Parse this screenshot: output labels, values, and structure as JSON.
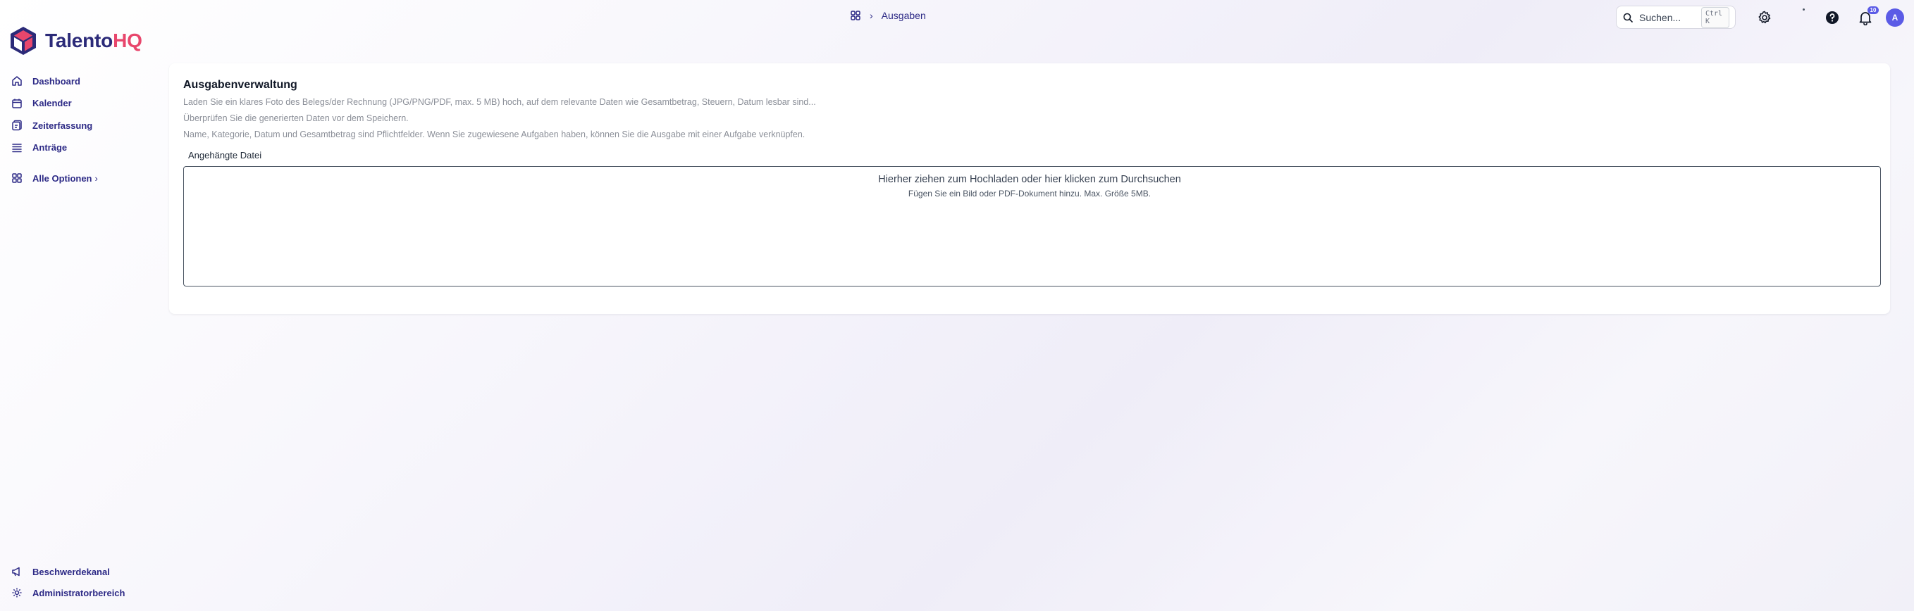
{
  "brand": {
    "name_part1": "Talento",
    "name_part2": "HQ"
  },
  "sidebar": {
    "items": [
      {
        "label": "Dashboard",
        "icon": "home-icon"
      },
      {
        "label": "Kalender",
        "icon": "calendar-icon"
      },
      {
        "label": "Zeiterfassung",
        "icon": "clipboard-clock-icon"
      },
      {
        "label": "Anträge",
        "icon": "list-icon"
      }
    ],
    "all_options": {
      "label": "Alle Optionen",
      "chevron": "›",
      "icon": "grid-icon"
    },
    "bottom": [
      {
        "label": "Beschwerdekanal",
        "icon": "megaphone-icon"
      },
      {
        "label": "Administratorbereich",
        "icon": "gear-icon"
      }
    ]
  },
  "breadcrumb": {
    "separator": "›",
    "current": "Ausgaben",
    "icon": "apps-grid-icon"
  },
  "search": {
    "placeholder": "Suchen...",
    "shortcut": "Ctrl K"
  },
  "header_icons": {
    "settings": "gear-icon",
    "help": "question-circle-icon",
    "notifications": "bell-icon",
    "notification_count": "10"
  },
  "user": {
    "avatar_initial": "A",
    "avatar_color": "#5b5be6"
  },
  "card": {
    "title": "Ausgabenverwaltung",
    "desc1": "Laden Sie ein klares Foto des Belegs/der Rechnung (JPG/PNG/PDF, max. 5 MB) hoch, auf dem relevante Daten wie Gesamtbetrag, Steuern, Datum lesbar sind...",
    "desc2": "Überprüfen Sie die generierten Daten vor dem Speichern.",
    "desc3": "Name, Kategorie, Datum und Gesamtbetrag sind Pflichtfelder. Wenn Sie zugewiesene Aufgaben haben, können Sie die Ausgabe mit einer Aufgabe verknüpfen.",
    "file_label": "Angehängte Datei",
    "dropzone_main": "Hierher ziehen zum Hochladen oder hier klicken zum Durchsuchen",
    "dropzone_sub": "Fügen Sie ein Bild oder PDF-Dokument hinzu. Max. Größe 5MB."
  },
  "colors": {
    "brand_navy": "#2b2a78",
    "brand_pink": "#e8466c",
    "nav_text": "#2d2a86",
    "accent": "#5b5be6"
  }
}
